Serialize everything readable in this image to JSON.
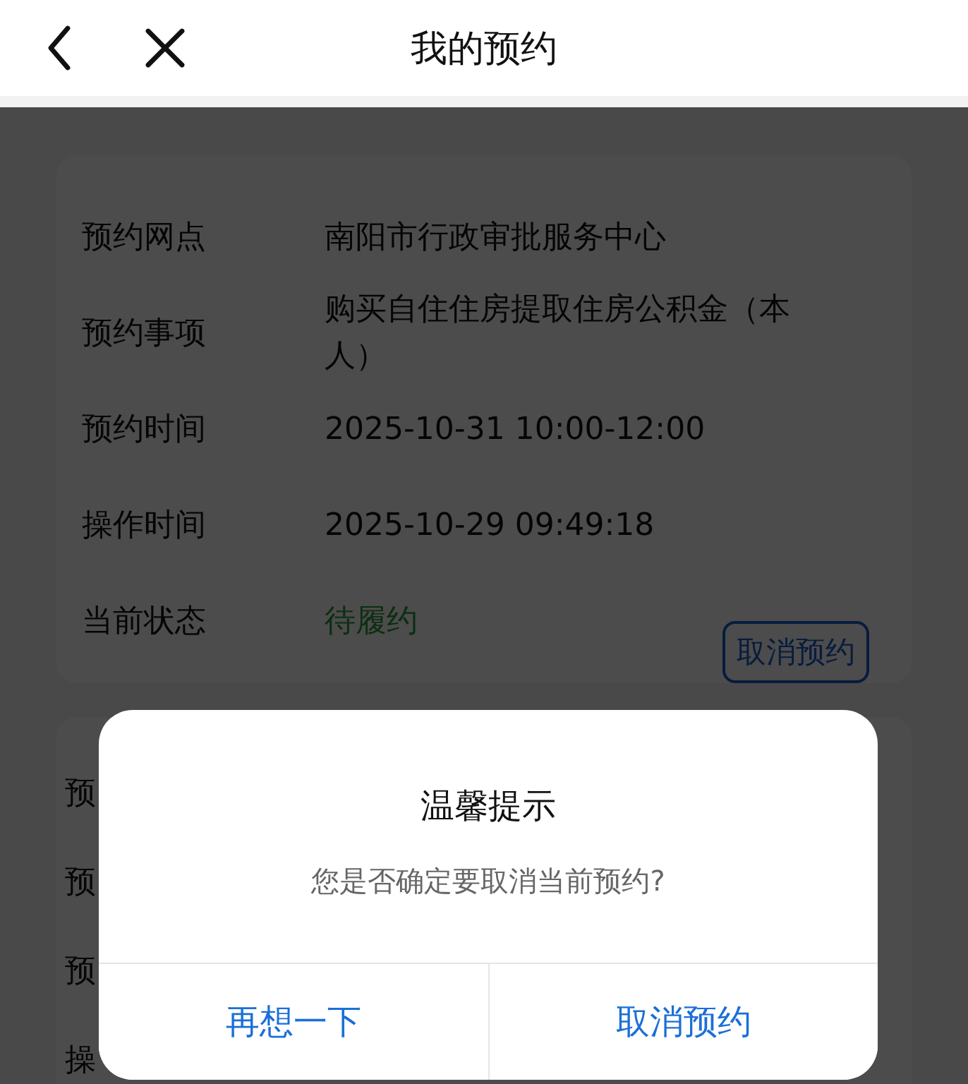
{
  "header": {
    "title": "我的预约"
  },
  "appointments": [
    {
      "fields": [
        {
          "label": "预约网点",
          "value": "南阳市行政审批服务中心",
          "kind": "text"
        },
        {
          "label": "预约事项",
          "value": "购买自住住房提取住房公积金（本人）",
          "kind": "text"
        },
        {
          "label": "预约时间",
          "value": "2025-10-31 10:00-12:00",
          "kind": "text"
        },
        {
          "label": "操作时间",
          "value": "2025-10-29 09:49:18",
          "kind": "text"
        },
        {
          "label": "当前状态",
          "value": "待履约",
          "kind": "status"
        }
      ],
      "action": "取消预约"
    },
    {
      "fields": [
        {
          "label": "预"
        },
        {
          "label": "预"
        },
        {
          "label": "预"
        },
        {
          "label": "操"
        }
      ]
    }
  ],
  "dialog": {
    "title": "温馨提示",
    "message": "您是否确定要取消当前预约?",
    "buttons": [
      {
        "label": "再想一下"
      },
      {
        "label": "取消预约"
      }
    ]
  }
}
